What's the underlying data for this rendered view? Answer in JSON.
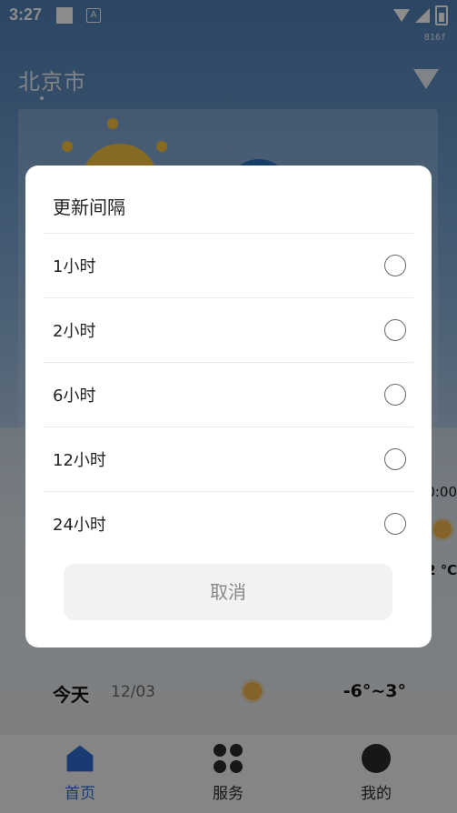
{
  "status_bar": {
    "time": "3:27",
    "fps": "816f"
  },
  "header": {
    "city": "北京市"
  },
  "background": {
    "right_time_fragment": "0:00",
    "right_temp_fragment": "2 ℃",
    "today_forecast": {
      "day": "今天",
      "date": "12/03",
      "temp_range": "-6°~3°"
    }
  },
  "bottom_nav": {
    "items": [
      {
        "label": "首页",
        "active": true,
        "icon": "home-icon",
        "color": "#2e6bd0"
      },
      {
        "label": "服务",
        "active": false,
        "icon": "grid-icon"
      },
      {
        "label": "我的",
        "active": false,
        "icon": "profile-icon"
      }
    ]
  },
  "dialog": {
    "title": "更新间隔",
    "options": [
      {
        "label": "1小时",
        "selected": false
      },
      {
        "label": "2小时",
        "selected": false
      },
      {
        "label": "6小时",
        "selected": false
      },
      {
        "label": "12小时",
        "selected": false
      },
      {
        "label": "24小时",
        "selected": false
      }
    ],
    "cancel_label": "取消"
  }
}
